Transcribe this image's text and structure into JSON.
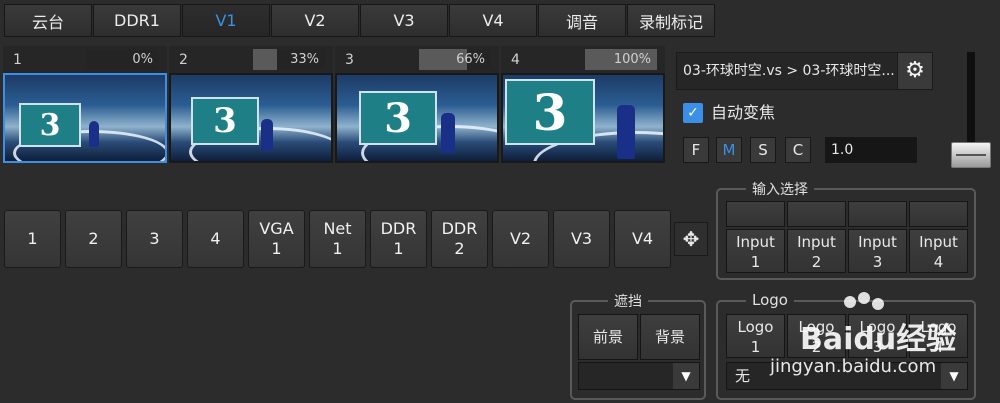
{
  "tabs": [
    {
      "label": "云台"
    },
    {
      "label": "DDR1"
    },
    {
      "label": "V1"
    },
    {
      "label": "V2"
    },
    {
      "label": "V3"
    },
    {
      "label": "V4"
    },
    {
      "label": "调音"
    },
    {
      "label": "录制标记"
    }
  ],
  "thumbnails": [
    {
      "num": "1",
      "percent": "0%",
      "level": 0
    },
    {
      "num": "2",
      "percent": "33%",
      "level": 0.33
    },
    {
      "num": "3",
      "percent": "66%",
      "level": 0.66
    },
    {
      "num": "4",
      "percent": "100%",
      "level": 1.0
    }
  ],
  "scene_board_text": "3",
  "scene_dropdown": {
    "value": "03-环球时空.vs > 03-环球时空..."
  },
  "autofocus": {
    "label": "自动变焦",
    "checked": true
  },
  "modes": {
    "f": "F",
    "m": "M",
    "s": "S",
    "c": "C"
  },
  "zoom_value": "1.0",
  "sources": [
    {
      "l1": "1",
      "l2": ""
    },
    {
      "l1": "2",
      "l2": ""
    },
    {
      "l1": "3",
      "l2": ""
    },
    {
      "l1": "4",
      "l2": ""
    },
    {
      "l1": "VGA",
      "l2": "1"
    },
    {
      "l1": "Net",
      "l2": "1"
    },
    {
      "l1": "DDR",
      "l2": "1"
    },
    {
      "l1": "DDR",
      "l2": "2"
    },
    {
      "l1": "V2",
      "l2": ""
    },
    {
      "l1": "V3",
      "l2": ""
    },
    {
      "l1": "V4",
      "l2": ""
    }
  ],
  "input_select": {
    "title": "输入选择",
    "inputs": [
      {
        "l1": "Input",
        "l2": "1"
      },
      {
        "l1": "Input",
        "l2": "2"
      },
      {
        "l1": "Input",
        "l2": "3"
      },
      {
        "l1": "Input",
        "l2": "4"
      }
    ]
  },
  "mask": {
    "title": "遮挡",
    "fg": "前景",
    "bg": "背景"
  },
  "logo": {
    "title": "Logo",
    "items": [
      {
        "l1": "Logo",
        "l2": "1"
      },
      {
        "l1": "Logo",
        "l2": "2"
      },
      {
        "l1": "Logo",
        "l2": "3"
      },
      {
        "l1": "Logo",
        "l2": "4"
      }
    ],
    "select_value": "无"
  },
  "watermark": {
    "brand": "Baidu经验",
    "url": "jingyan.baidu.com"
  },
  "colors": {
    "accent": "#3b8fe6",
    "background": "#2c2c2c"
  }
}
